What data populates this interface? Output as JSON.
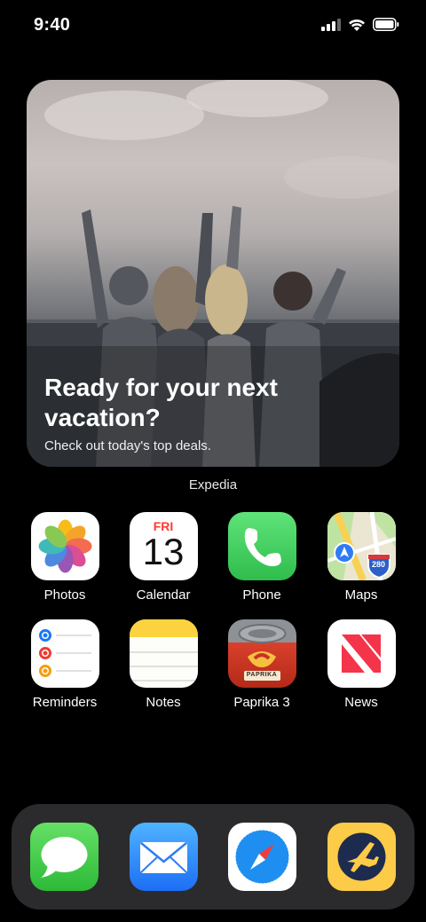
{
  "status_bar": {
    "time": "9:40"
  },
  "widget": {
    "title": "Ready for your next vacation?",
    "subtitle": "Check out today's top deals.",
    "caption": "Expedia"
  },
  "apps": [
    {
      "label": "Photos",
      "icon": "photos-icon"
    },
    {
      "label": "Calendar",
      "icon": "calendar-icon",
      "day_name": "FRI",
      "day_number": "13"
    },
    {
      "label": "Phone",
      "icon": "phone-icon"
    },
    {
      "label": "Maps",
      "icon": "maps-icon",
      "shield_text": "280"
    },
    {
      "label": "Reminders",
      "icon": "reminders-icon"
    },
    {
      "label": "Notes",
      "icon": "notes-icon"
    },
    {
      "label": "Paprika 3",
      "icon": "paprika-icon",
      "banner_text": "PAPRIKA"
    },
    {
      "label": "News",
      "icon": "news-icon"
    }
  ],
  "dock": [
    {
      "icon": "messages-icon"
    },
    {
      "icon": "mail-icon"
    },
    {
      "icon": "safari-icon"
    },
    {
      "icon": "expedia-icon"
    }
  ],
  "colors": {
    "phone_green": "#34c759",
    "calendar_red": "#ff3b30",
    "notes_yellow": "#ffd60a",
    "expedia_yellow": "#fccb48",
    "dock_bg": "#2b2b2d"
  }
}
